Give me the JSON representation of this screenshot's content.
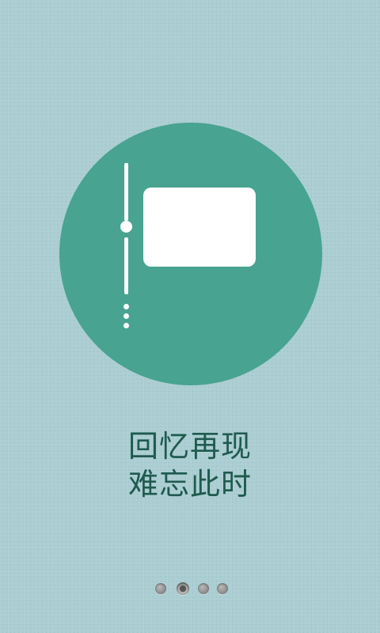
{
  "screen": {
    "background_color": "#a9cdd2",
    "circle_color": "#48a391",
    "text_color": "#1f5a4e"
  },
  "illustration": {
    "icon": "timeline-photo-icon"
  },
  "headline": {
    "line1": "回忆再现",
    "line2": "难忘此时"
  },
  "pager": {
    "page_count": 4,
    "active_page": 2
  }
}
